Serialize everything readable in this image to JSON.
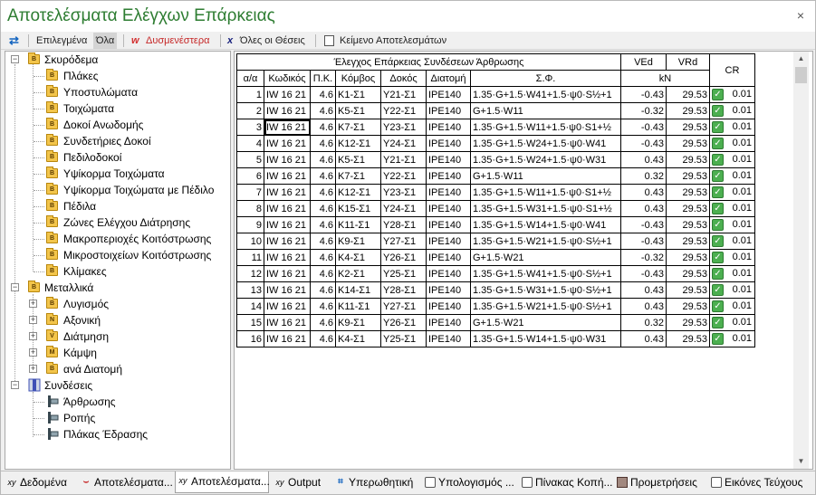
{
  "window": {
    "title": "Αποτελέσματα Ελέγχων Επάρκειας",
    "close": "×"
  },
  "toolbar": {
    "swap_icon": "⇄",
    "selected": "Επιλεγμένα",
    "all": "Όλα",
    "unfavorable_marker": "w",
    "unfavorable": "Δυσμενέστερα",
    "all_positions_marker": "x",
    "all_positions": "Όλες οι Θέσεις",
    "results_text": "Κείμενο Αποτελεσμάτων"
  },
  "tree": {
    "concrete": {
      "label": "Σκυρόδεμα",
      "items": [
        "Πλάκες",
        "Υποστυλώματα",
        "Τοιχώματα",
        "Δοκοί Ανωδομής",
        "Συνδετήριες Δοκοί",
        "Πεδιλοδοκοί",
        "Υψίκορμα Τοιχώματα",
        "Υψίκορμα Τοιχώματα με Πέδιλο",
        "Πέδιλα",
        "Ζώνες Ελέγχου Διάτρησης",
        "Μακροπεριοχές Κοιτόστρωσης",
        "Μικροστοιχείων Κοιτόστρωσης",
        "Κλίμακες"
      ]
    },
    "steel": {
      "label": "Μεταλλικά",
      "items": [
        {
          "label": "Λυγισμός",
          "badge": "B"
        },
        {
          "label": "Αξονική",
          "badge": "N"
        },
        {
          "label": "Διάτμηση",
          "badge": "V"
        },
        {
          "label": "Κάμψη",
          "badge": "M"
        },
        {
          "label": "ανά Διατομή",
          "badge": "B"
        }
      ]
    },
    "connections": {
      "label": "Συνδέσεις",
      "items": [
        "Άρθρωσης",
        "Ροπής",
        "Πλάκας Έδρασης"
      ]
    },
    "expand_minus": "−",
    "expand_plus": "+",
    "folder_badge": "B"
  },
  "grid": {
    "caption": "Έλεγχος Επάρκειας Συνδέσεων Άρθρωσης",
    "headers": {
      "aa": "α/α",
      "code": "Κωδικός",
      "pk": "Π.Κ.",
      "node": "Κόμβος",
      "beam": "Δοκός",
      "section": "Διατομή",
      "sf": "Σ.Φ.",
      "ved": "VEd",
      "vrd": "VRd",
      "unit": "kN",
      "cr": "CR"
    },
    "check_mark": "✓",
    "rows": [
      [
        "1",
        "IW 16 21",
        "4.6",
        "K1-Σ1",
        "Y21-Σ1",
        "IPE140",
        "1.35·G+1.5·W41+1.5·ψ0·S½+1",
        "-0.43",
        "29.53",
        "0.01"
      ],
      [
        "2",
        "IW 16 21",
        "4.6",
        "K5-Σ1",
        "Y22-Σ1",
        "IPE140",
        "G+1.5·W11",
        "-0.32",
        "29.53",
        "0.01"
      ],
      [
        "3",
        "IW 16 21",
        "4.6",
        "K7-Σ1",
        "Y23-Σ1",
        "IPE140",
        "1.35·G+1.5·W11+1.5·ψ0·S1+½",
        "-0.43",
        "29.53",
        "0.01"
      ],
      [
        "4",
        "IW 16 21",
        "4.6",
        "K12-Σ1",
        "Y24-Σ1",
        "IPE140",
        "1.35·G+1.5·W24+1.5·ψ0·W41",
        "-0.43",
        "29.53",
        "0.01"
      ],
      [
        "5",
        "IW 16 21",
        "4.6",
        "K5-Σ1",
        "Y21-Σ1",
        "IPE140",
        "1.35·G+1.5·W24+1.5·ψ0·W31",
        "0.43",
        "29.53",
        "0.01"
      ],
      [
        "6",
        "IW 16 21",
        "4.6",
        "K7-Σ1",
        "Y22-Σ1",
        "IPE140",
        "G+1.5·W11",
        "0.32",
        "29.53",
        "0.01"
      ],
      [
        "7",
        "IW 16 21",
        "4.6",
        "K12-Σ1",
        "Y23-Σ1",
        "IPE140",
        "1.35·G+1.5·W11+1.5·ψ0·S1+½",
        "0.43",
        "29.53",
        "0.01"
      ],
      [
        "8",
        "IW 16 21",
        "4.6",
        "K15-Σ1",
        "Y24-Σ1",
        "IPE140",
        "1.35·G+1.5·W31+1.5·ψ0·S1+½",
        "0.43",
        "29.53",
        "0.01"
      ],
      [
        "9",
        "IW 16 21",
        "4.6",
        "K11-Σ1",
        "Y28-Σ1",
        "IPE140",
        "1.35·G+1.5·W14+1.5·ψ0·W41",
        "-0.43",
        "29.53",
        "0.01"
      ],
      [
        "10",
        "IW 16 21",
        "4.6",
        "K9-Σ1",
        "Y27-Σ1",
        "IPE140",
        "1.35·G+1.5·W21+1.5·ψ0·S½+1",
        "-0.43",
        "29.53",
        "0.01"
      ],
      [
        "11",
        "IW 16 21",
        "4.6",
        "K4-Σ1",
        "Y26-Σ1",
        "IPE140",
        "G+1.5·W21",
        "-0.32",
        "29.53",
        "0.01"
      ],
      [
        "12",
        "IW 16 21",
        "4.6",
        "K2-Σ1",
        "Y25-Σ1",
        "IPE140",
        "1.35·G+1.5·W41+1.5·ψ0·S½+1",
        "-0.43",
        "29.53",
        "0.01"
      ],
      [
        "13",
        "IW 16 21",
        "4.6",
        "K14-Σ1",
        "Y28-Σ1",
        "IPE140",
        "1.35·G+1.5·W31+1.5·ψ0·S½+1",
        "0.43",
        "29.53",
        "0.01"
      ],
      [
        "14",
        "IW 16 21",
        "4.6",
        "K11-Σ1",
        "Y27-Σ1",
        "IPE140",
        "1.35·G+1.5·W21+1.5·ψ0·S½+1",
        "0.43",
        "29.53",
        "0.01"
      ],
      [
        "15",
        "IW 16 21",
        "4.6",
        "K9-Σ1",
        "Y26-Σ1",
        "IPE140",
        "G+1.5·W21",
        "0.32",
        "29.53",
        "0.01"
      ],
      [
        "16",
        "IW 16 21",
        "4.6",
        "K4-Σ1",
        "Y25-Σ1",
        "IPE140",
        "1.35·G+1.5·W14+1.5·ψ0·W31",
        "0.43",
        "29.53",
        "0.01"
      ]
    ]
  },
  "tabs": [
    {
      "label": "Δεδομένα",
      "icon": "xy-icon",
      "glyph": "xy"
    },
    {
      "label": "Αποτελέσματα...",
      "icon": "beam-icon",
      "glyph": "⌣"
    },
    {
      "label": "Αποτελέσματα...",
      "icon": "xy-icon",
      "glyph": "xy"
    },
    {
      "label": "Output",
      "icon": "xy-icon",
      "glyph": "xy"
    },
    {
      "label": "Υπερωθητική",
      "icon": "frame-icon",
      "glyph": "⌗"
    },
    {
      "label": "Υπολογισμός ...",
      "icon": "document-icon",
      "glyph": ""
    },
    {
      "label": "Πίνακας Κοπή...",
      "icon": "document-icon",
      "glyph": ""
    },
    {
      "label": "Προμετρήσεις",
      "icon": "box-icon",
      "glyph": ""
    },
    {
      "label": "Εικόνες Τεύχους",
      "icon": "document-icon",
      "glyph": ""
    }
  ],
  "scrollbar": {
    "up": "▲",
    "down": "▼"
  }
}
